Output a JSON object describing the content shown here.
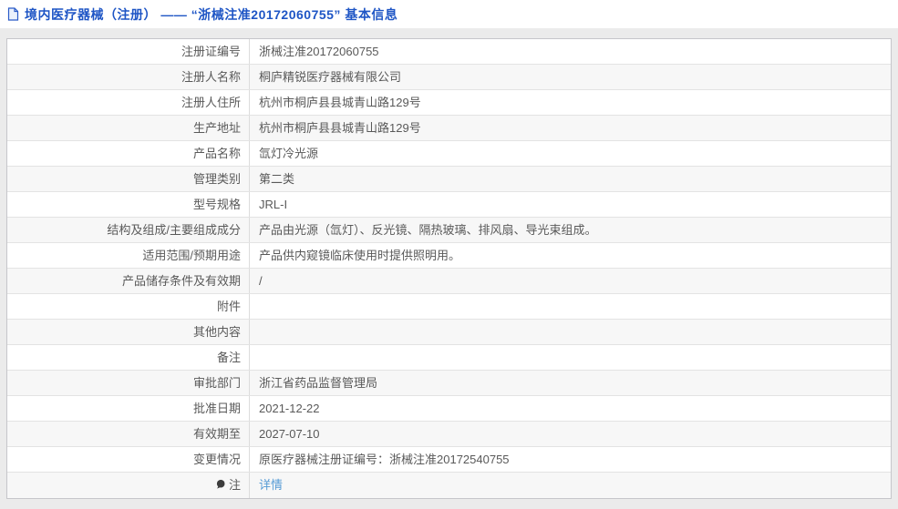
{
  "header": {
    "title": "境内医疗器械（注册） —— “浙械注准20172060755” 基本信息",
    "icon": "document-icon"
  },
  "colors": {
    "title_blue": "#1e55c5",
    "link_blue": "#569bd5",
    "row_alt_bg": "#f7f7f7",
    "table_text": "#595959",
    "page_bg": "#ebebeb"
  },
  "table": {
    "rows": [
      {
        "label": "注册证编号",
        "value": "浙械注准20172060755"
      },
      {
        "label": "注册人名称",
        "value": "桐庐精锐医疗器械有限公司"
      },
      {
        "label": "注册人住所",
        "value": "杭州市桐庐县县城青山路129号"
      },
      {
        "label": "生产地址",
        "value": "杭州市桐庐县县城青山路129号"
      },
      {
        "label": "产品名称",
        "value": "氙灯冷光源"
      },
      {
        "label": "管理类别",
        "value": "第二类"
      },
      {
        "label": "型号规格",
        "value": "JRL-I"
      },
      {
        "label": "结构及组成/主要组成成分",
        "value": "产品由光源（氙灯）、反光镜、隔热玻璃、排风扇、导光束组成。"
      },
      {
        "label": "适用范围/预期用途",
        "value": "产品供内窥镜临床使用时提供照明用。"
      },
      {
        "label": "产品储存条件及有效期",
        "value": "/"
      },
      {
        "label": "附件",
        "value": ""
      },
      {
        "label": "其他内容",
        "value": ""
      },
      {
        "label": "备注",
        "value": ""
      },
      {
        "label": "审批部门",
        "value": "浙江省药品监督管理局"
      },
      {
        "label": "批准日期",
        "value": "2021-12-22"
      },
      {
        "label": "有效期至",
        "value": "2027-07-10"
      },
      {
        "label": "变更情况",
        "value": "原医疗器械注册证编号：浙械注准20172540755"
      },
      {
        "label": "注",
        "value": "详情",
        "icon": "note-icon",
        "value_is_link": true
      }
    ]
  }
}
